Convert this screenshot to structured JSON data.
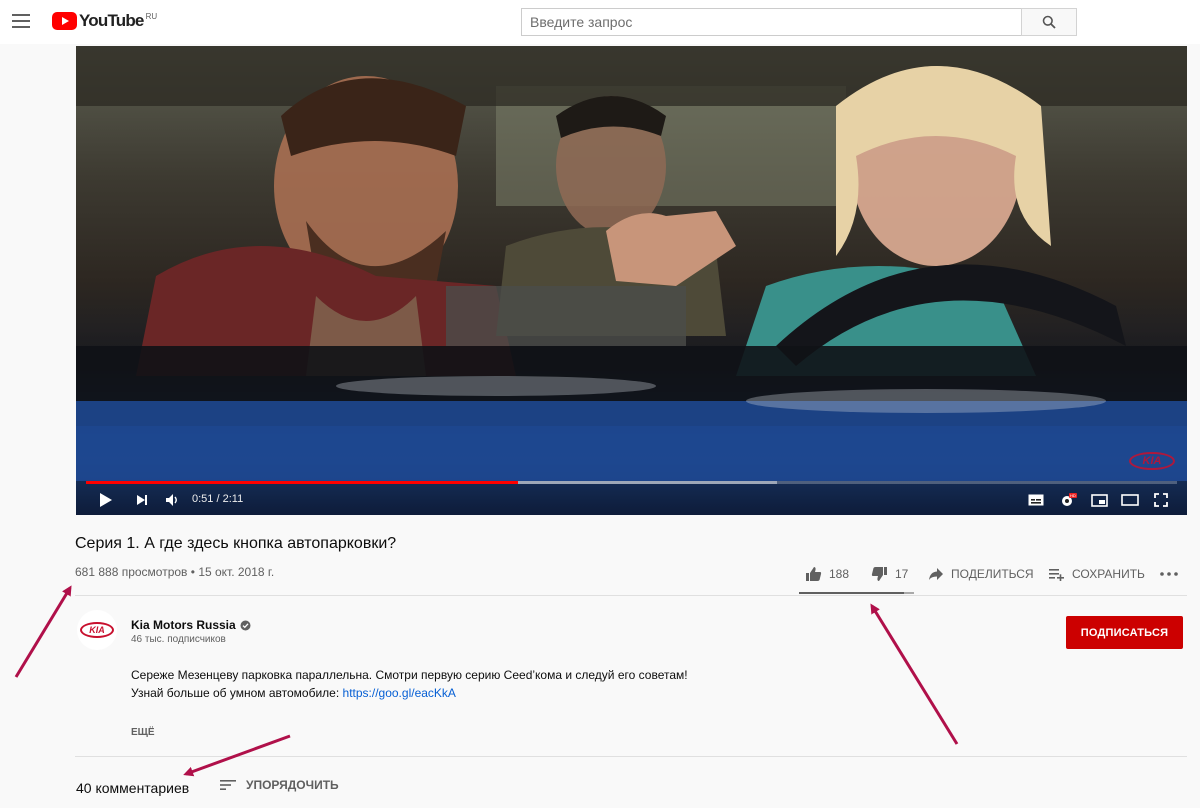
{
  "header": {
    "logo_text": "YouTube",
    "logo_region": "RU",
    "search_placeholder": "Введите запрос"
  },
  "player": {
    "time_current": "0:51",
    "time_separator": " / ",
    "time_total": "2:11",
    "progress_played": 0.396,
    "progress_loaded": 0.633,
    "watermark": "KIA"
  },
  "video": {
    "title": "Серия 1. А где здесь кнопка автопарковки?",
    "views": "681 888 просмотров",
    "date_separator": " • ",
    "date": "15 окт. 2018 г.",
    "likes": "188",
    "dislikes": "17",
    "share_label": "ПОДЕЛИТЬСЯ",
    "save_label": "СОХРАНИТЬ",
    "like_ratio": 0.917
  },
  "owner": {
    "avatar_text": "KIA",
    "channel_name": "Kia Motors Russia",
    "subscribers": "46 тыс. подписчиков",
    "subscribe_label": "ПОДПИСАТЬСЯ"
  },
  "description": {
    "line1": "Сереже Мезенцеву парковка параллельна. Смотри первую серию Ceed’кома и следуй его советам!",
    "line2_prefix": "Узнай больше об умном автомобиле: ",
    "link": "https://goo.gl/eacKkA",
    "more_label": "ЕЩЁ"
  },
  "comments": {
    "count": "40 комментариев",
    "sort_label": "УПОРЯДОЧИТЬ"
  },
  "colors": {
    "brand_red": "#ff0000",
    "subscribe_red": "#cc0000",
    "link_blue": "#065fd4",
    "annotation_arrow": "#b0104a"
  }
}
